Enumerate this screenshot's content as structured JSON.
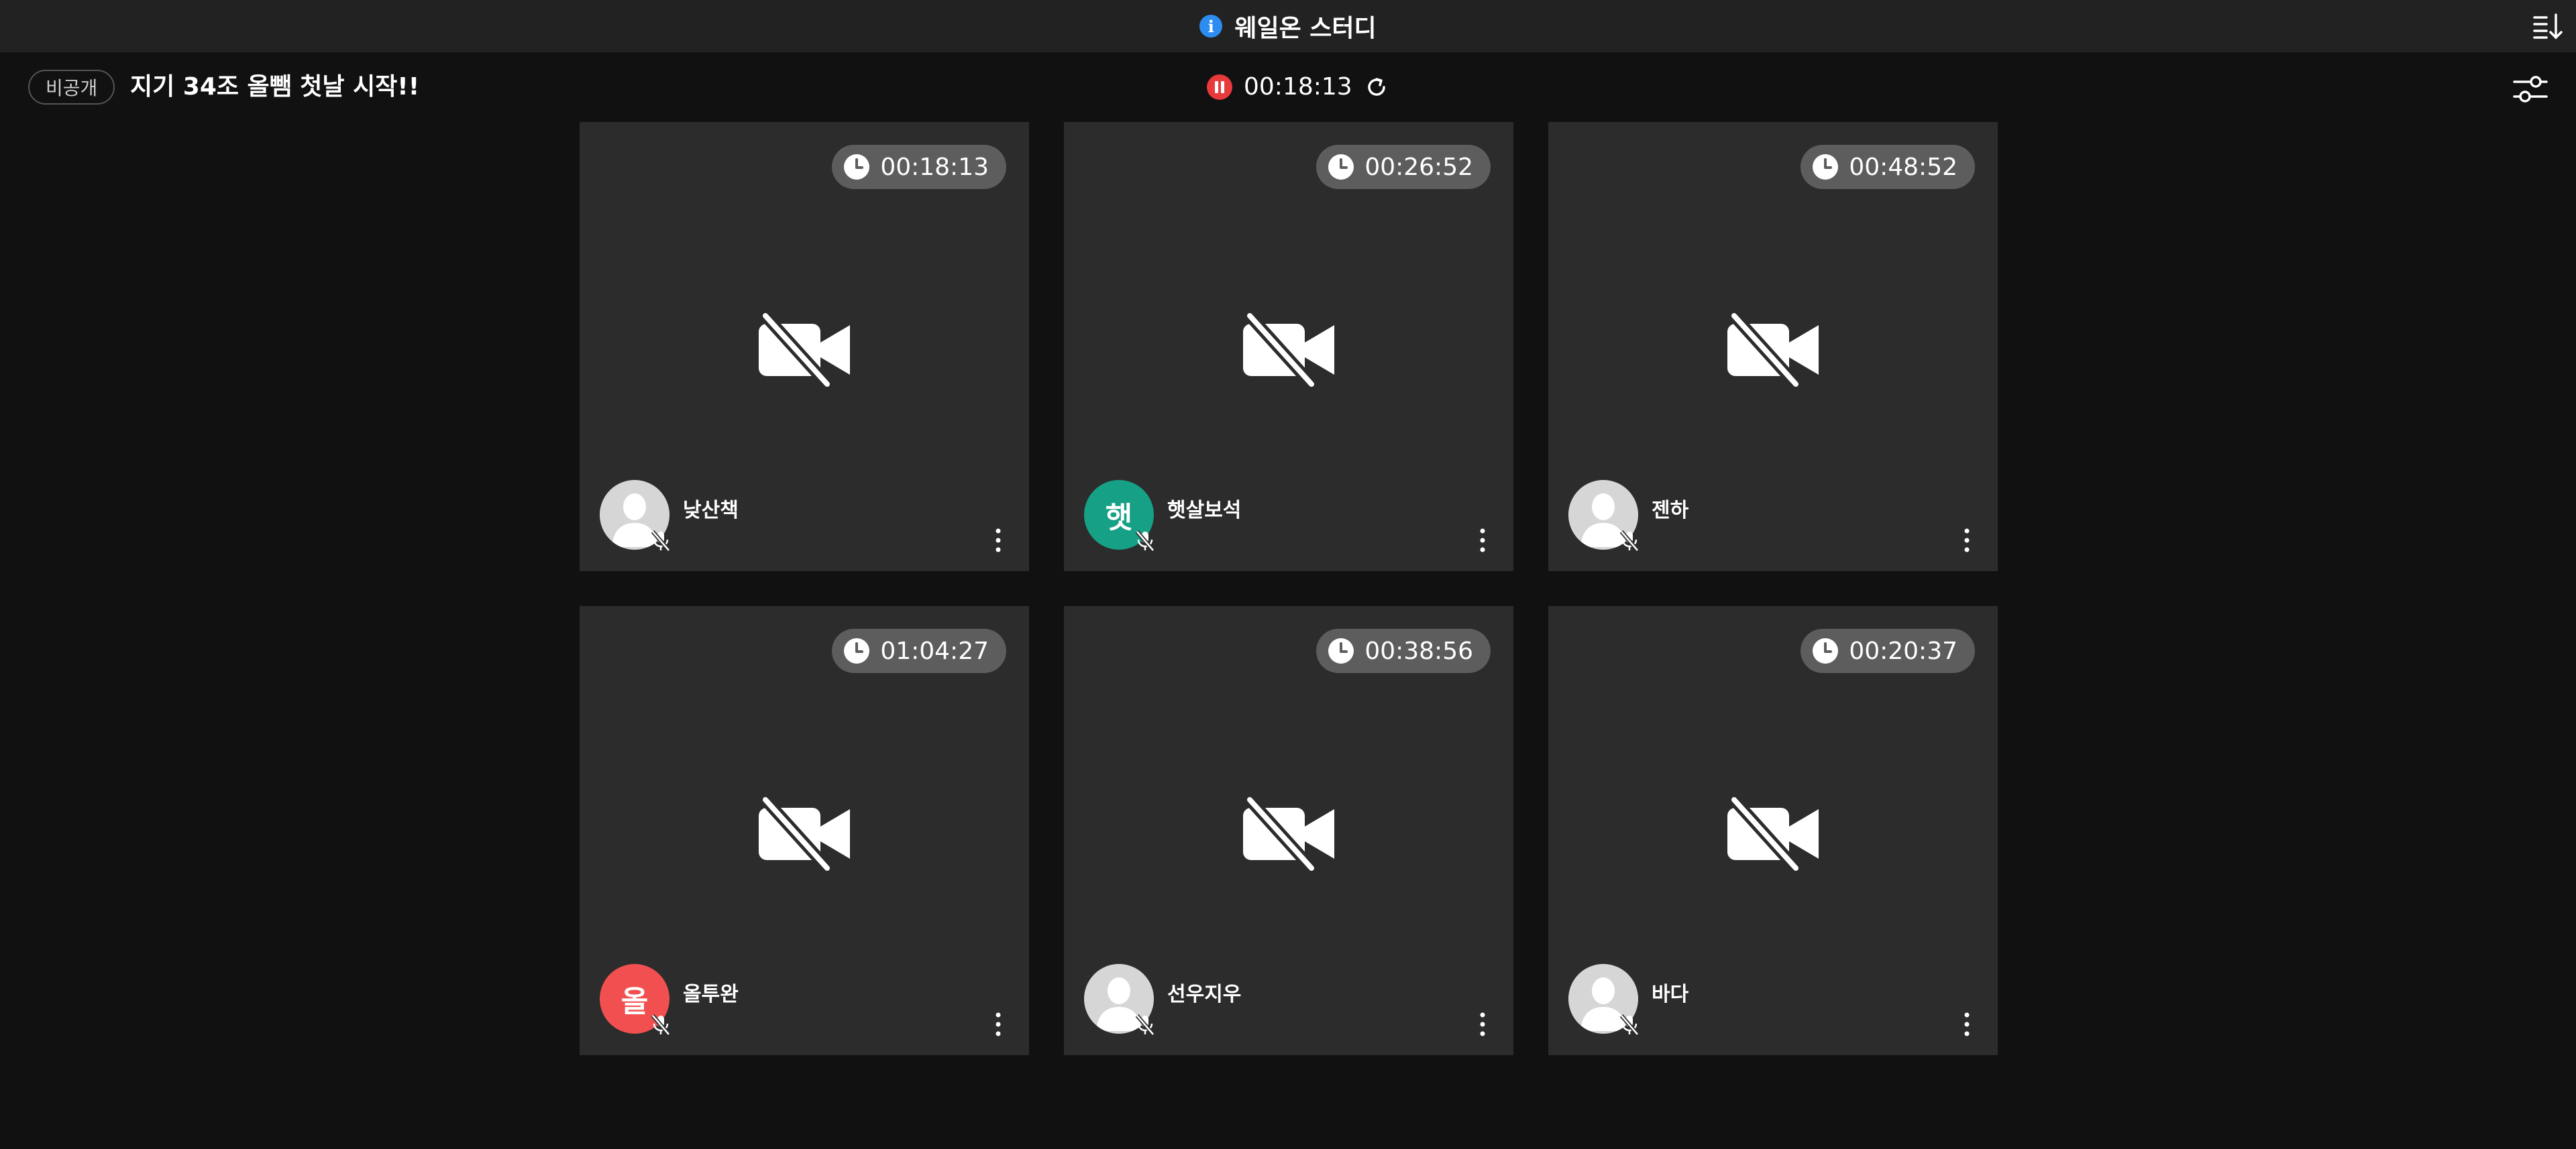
{
  "app": {
    "title": "웨일온 스터디",
    "accent": "#2d8cf0"
  },
  "room": {
    "visibility": "비공개",
    "title": "지기 34조 올뺌 첫날 시작!!",
    "timer": "00:18:13",
    "record_color": "#e8393b"
  },
  "participants": [
    {
      "name": "낮산책",
      "time": "00:18:13",
      "avatar_type": "default",
      "initial": "",
      "avatar_color": "#d6d6d6"
    },
    {
      "name": "햇살보석",
      "time": "00:26:52",
      "avatar_type": "initial",
      "initial": "햇",
      "avatar_color": "#16a085"
    },
    {
      "name": "젠하",
      "time": "00:48:52",
      "avatar_type": "default",
      "initial": "",
      "avatar_color": "#d6d6d6"
    },
    {
      "name": "올투완",
      "time": "01:04:27",
      "avatar_type": "initial",
      "initial": "올",
      "avatar_color": "#f25050"
    },
    {
      "name": "선우지우",
      "time": "00:38:56",
      "avatar_type": "default",
      "initial": "",
      "avatar_color": "#d6d6d6"
    },
    {
      "name": "바다",
      "time": "00:20:37",
      "avatar_type": "default",
      "initial": "",
      "avatar_color": "#d6d6d6"
    }
  ],
  "icons": {
    "tile_clock": "clock-icon",
    "tile_camera": "camera-off-icon",
    "tile_mic": "mic-off-icon",
    "tile_menu": "more-vertical-icon"
  }
}
